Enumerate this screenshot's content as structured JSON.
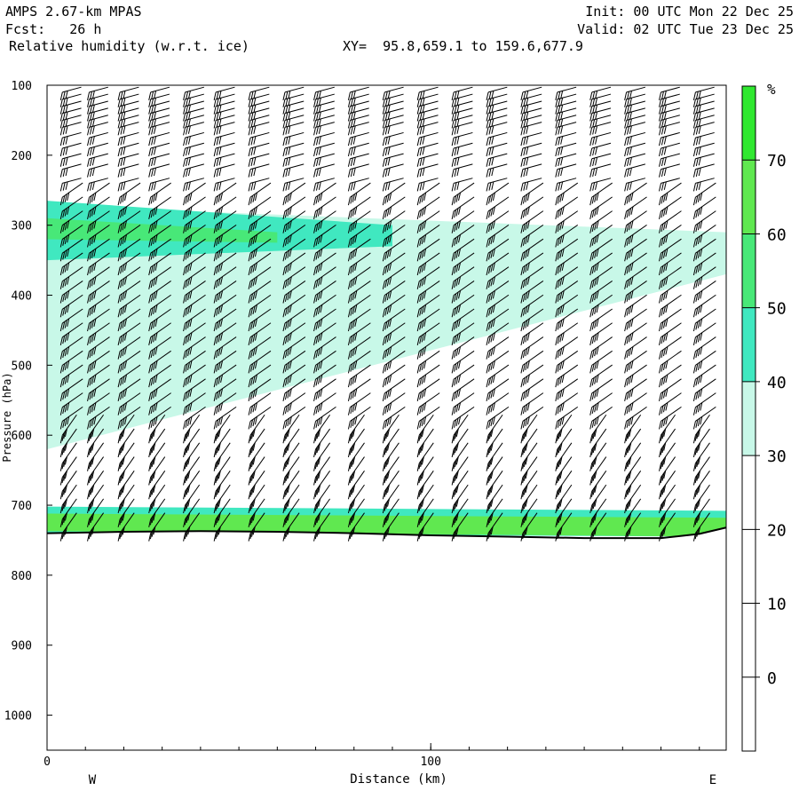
{
  "header": {
    "model": "AMPS 2.67-km MPAS",
    "forecast": "Fcst:   26 h",
    "field": "Relative humidity (w.r.t. ice)",
    "xy": "XY=  95.8,659.1 to 159.6,677.9",
    "init": "Init: 00 UTC Mon 22 Dec 25",
    "valid": "Valid: 02 UTC Tue 23 Dec 25"
  },
  "chart_data": {
    "type": "heatmap",
    "title": "Relative humidity (w.r.t. ice)",
    "xlabel": "Distance (km)",
    "ylabel": "Pressure (hPa)",
    "xlim": [
      0,
      177
    ],
    "ylim": [
      1050,
      100
    ],
    "x_ticks": [
      0,
      100
    ],
    "y_ticks": [
      100,
      200,
      300,
      400,
      500,
      600,
      700,
      800,
      900,
      1000
    ],
    "x_end_labels": {
      "left": "W",
      "right": "E"
    },
    "colorbar": {
      "unit": "%",
      "ticks": [
        0,
        10,
        20,
        30,
        40,
        50,
        60,
        70
      ],
      "bands": [
        {
          "from": 30,
          "to": 40,
          "color": "#c8f8e8"
        },
        {
          "from": 40,
          "to": 50,
          "color": "#40e8c0"
        },
        {
          "from": 50,
          "to": 60,
          "color": "#48e878"
        },
        {
          "from": 60,
          "to": 70,
          "color": "#60e850"
        },
        {
          "from": 70,
          "to": 80,
          "color": "#30e830"
        }
      ]
    },
    "terrain_pressure": [
      [
        0,
        740
      ],
      [
        20,
        738
      ],
      [
        40,
        737
      ],
      [
        60,
        738
      ],
      [
        80,
        740
      ],
      [
        100,
        743
      ],
      [
        120,
        745
      ],
      [
        140,
        747
      ],
      [
        160,
        747
      ],
      [
        170,
        741
      ],
      [
        177,
        732
      ]
    ],
    "rh_regions": [
      {
        "level": 30,
        "x": [
          0,
          177
        ],
        "p_top": [
          272,
          310
        ],
        "p_bot": [
          620,
          370
        ]
      },
      {
        "level": 40,
        "x": [
          0,
          90
        ],
        "p_top": [
          265,
          300
        ],
        "p_bot": [
          350,
          330
        ]
      },
      {
        "level": 50,
        "x": [
          0,
          60
        ],
        "p_top": [
          290,
          310
        ],
        "p_bot": [
          320,
          325
        ]
      },
      {
        "level": 40,
        "x": [
          0,
          177
        ],
        "p_top": [
          702,
          708
        ],
        "p_bot": [
          740,
          745
        ]
      },
      {
        "level": 60,
        "x": [
          0,
          177
        ],
        "p_top": [
          712,
          718
        ],
        "p_bot": [
          737,
          745
        ]
      }
    ],
    "wind_barb_columns_km": [
      4,
      11,
      19,
      27,
      36,
      44,
      53,
      62,
      70,
      79,
      88,
      97,
      106,
      115,
      124,
      133,
      142,
      151,
      160,
      169
    ],
    "wind_barb_levels_hpa": [
      110,
      120,
      130,
      140,
      150,
      160,
      175,
      190,
      205,
      220,
      240,
      260,
      280,
      300,
      320,
      340,
      360,
      380,
      400,
      420,
      440,
      460,
      480,
      500,
      520,
      540,
      560,
      580,
      600,
      620,
      640,
      660,
      680,
      700,
      720,
      740
    ],
    "grid": false,
    "legend": "right"
  }
}
